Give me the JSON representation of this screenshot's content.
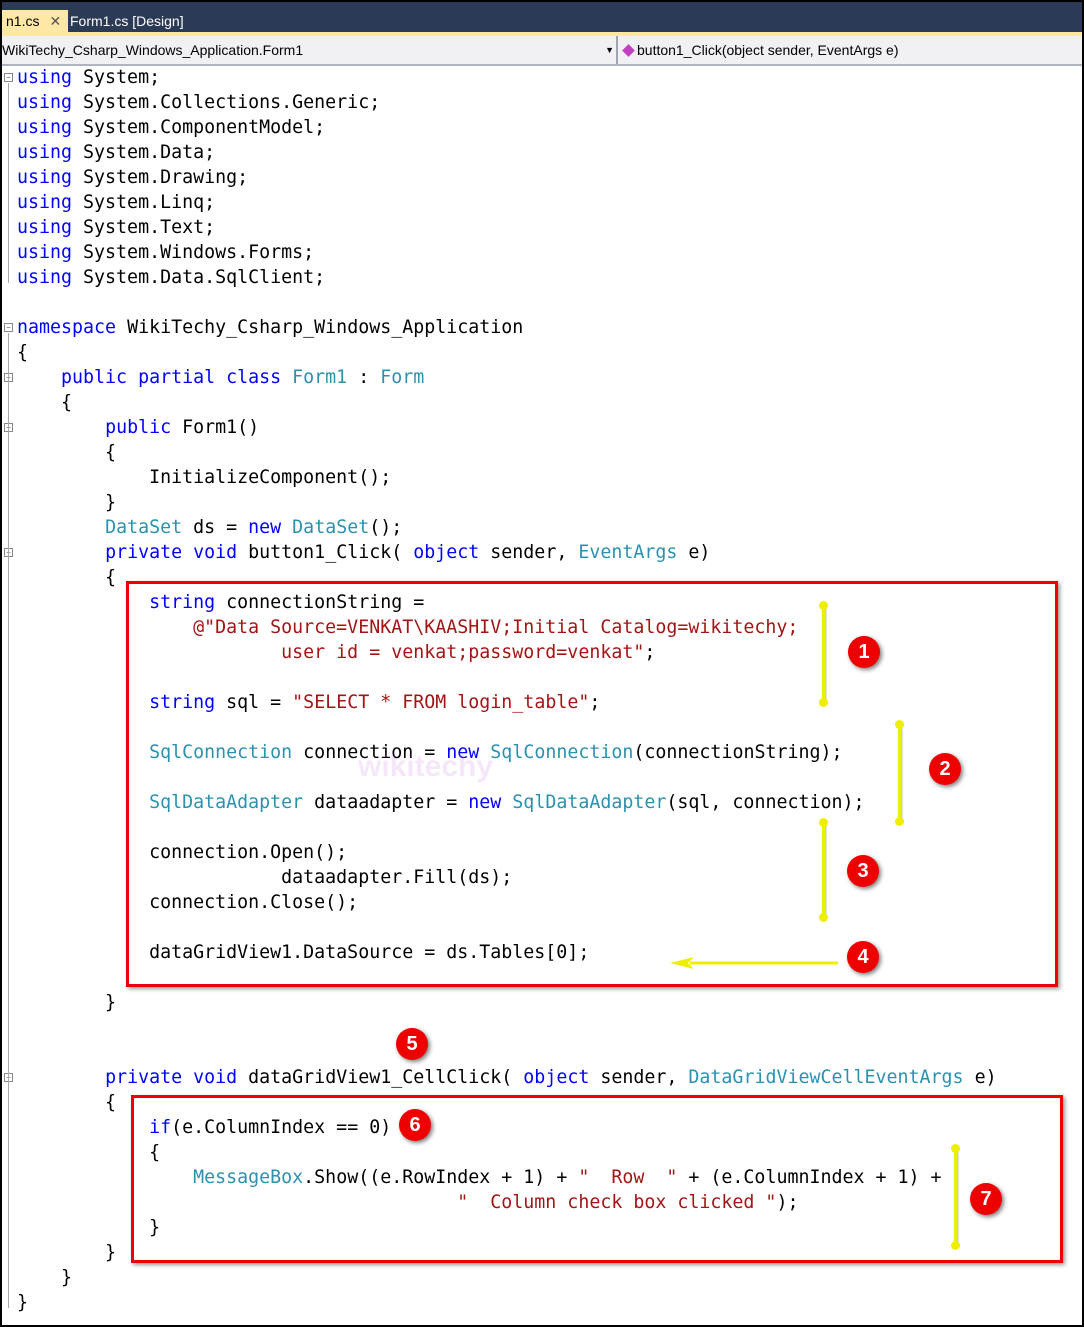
{
  "tabs": [
    {
      "label": "n1.cs",
      "close": "✕"
    },
    {
      "label": "Form1.cs [Design]"
    }
  ],
  "nav": {
    "class_selector": "WikiTechy_Csharp_Windows_Application.Form1",
    "member_selector": "button1_Click(object sender, EventArgs e)"
  },
  "watermark": "wikitechy",
  "colors": {
    "keyword": "#0000ff",
    "type": "#2b91af",
    "string": "#a31515",
    "annotation_box": "#ee0000",
    "annotation_line": "#eeee00"
  },
  "annotations": [
    "1",
    "2",
    "3",
    "4",
    "5",
    "6",
    "7"
  ],
  "code": [
    [
      [
        "kw",
        "using"
      ],
      [
        "",
        "System;"
      ]
    ],
    [
      [
        "kw",
        "using"
      ],
      [
        "",
        "System.Collections.Generic;"
      ]
    ],
    [
      [
        "kw",
        "using"
      ],
      [
        "",
        "System.ComponentModel;"
      ]
    ],
    [
      [
        "kw",
        "using"
      ],
      [
        "",
        "System.Data;"
      ]
    ],
    [
      [
        "kw",
        "using"
      ],
      [
        "",
        "System.Drawing;"
      ]
    ],
    [
      [
        "kw",
        "using"
      ],
      [
        "",
        "System.Linq;"
      ]
    ],
    [
      [
        "kw",
        "using"
      ],
      [
        "",
        "System.Text;"
      ]
    ],
    [
      [
        "kw",
        "using"
      ],
      [
        "",
        "System.Windows.Forms;"
      ]
    ],
    [
      [
        "kw",
        "using"
      ],
      [
        "",
        "System.Data.SqlClient;"
      ]
    ],
    [],
    [
      [
        "kw",
        "namespace"
      ],
      [
        "",
        "WikiTechy_Csharp_Windows_Application"
      ]
    ],
    [
      [
        "",
        "{"
      ]
    ],
    [
      [
        "",
        "    "
      ],
      [
        "kw",
        "public partial class"
      ],
      [
        "ty",
        "Form1"
      ],
      [
        "",
        ":"
      ],
      [
        "ty",
        "Form"
      ]
    ],
    [
      [
        "",
        "    {"
      ]
    ],
    [
      [
        "",
        "        "
      ],
      [
        "kw",
        "public"
      ],
      [
        "",
        "Form1()"
      ]
    ],
    [
      [
        "",
        "        {"
      ]
    ],
    [
      [
        "",
        "            InitializeComponent();"
      ]
    ],
    [
      [
        "",
        "        }"
      ]
    ],
    [
      [
        "",
        "        "
      ],
      [
        "ty",
        "DataSet"
      ],
      [
        "",
        "ds ="
      ],
      [
        "kw",
        "new"
      ],
      [
        "ty",
        "DataSet"
      ],
      [
        "",
        "();"
      ]
    ],
    [
      [
        "",
        "        "
      ],
      [
        "kw",
        "private void"
      ],
      [
        "",
        "button1_Click("
      ],
      [
        "kw",
        "object"
      ],
      [
        "",
        "sender,"
      ],
      [
        "ty",
        "EventArgs"
      ],
      [
        "",
        "e)"
      ]
    ],
    [
      [
        "",
        "        {"
      ]
    ],
    [
      [
        "",
        "            "
      ],
      [
        "kw",
        "string"
      ],
      [
        "",
        "connectionString ="
      ]
    ],
    [
      [
        "st",
        "                @\"Data Source=VENKAT\\KAASHIV;Initial Catalog=wikitechy;"
      ]
    ],
    [
      [
        "st",
        "                        user id = venkat;password=venkat\""
      ],
      [
        "",
        ";"
      ]
    ],
    [],
    [
      [
        "",
        "            "
      ],
      [
        "kw",
        "string"
      ],
      [
        "",
        "sql ="
      ],
      [
        "st",
        "\"SELECT * FROM login_table\""
      ],
      [
        "",
        ";"
      ]
    ],
    [],
    [
      [
        "",
        "            "
      ],
      [
        "ty",
        "SqlConnection"
      ],
      [
        "",
        "connection ="
      ],
      [
        "kw",
        "new"
      ],
      [
        "ty",
        "SqlConnection"
      ],
      [
        "",
        "(connectionString);"
      ]
    ],
    [],
    [
      [
        "",
        "            "
      ],
      [
        "ty",
        "SqlDataAdapter"
      ],
      [
        "",
        "dataadapter ="
      ],
      [
        "kw",
        "new"
      ],
      [
        "ty",
        "SqlDataAdapter"
      ],
      [
        "",
        "(sql, connection);"
      ]
    ],
    [],
    [
      [
        "",
        "            connection.Open();"
      ]
    ],
    [
      [
        "",
        "                        dataadapter.Fill(ds);"
      ]
    ],
    [
      [
        "",
        "            connection.Close();"
      ]
    ],
    [],
    [
      [
        "",
        "            dataGridView1.DataSource = ds.Tables[0];"
      ]
    ],
    [],
    [
      [
        "",
        "        }"
      ]
    ],
    [],
    [],
    [
      [
        "",
        "        "
      ],
      [
        "kw",
        "private void"
      ],
      [
        "",
        "dataGridView1_CellClick("
      ],
      [
        "kw",
        "object"
      ],
      [
        "",
        "sender,"
      ],
      [
        "ty",
        "DataGridViewCellEventArgs"
      ],
      [
        "",
        "e)"
      ]
    ],
    [
      [
        "",
        "        {"
      ]
    ],
    [
      [
        "",
        "            "
      ],
      [
        "kw",
        "if"
      ],
      [
        "",
        "(e.ColumnIndex == 0)"
      ]
    ],
    [
      [
        "",
        "            {"
      ]
    ],
    [
      [
        "",
        "                "
      ],
      [
        "ty",
        "MessageBox"
      ],
      [
        "",
        ".Show((e.RowIndex + 1) + "
      ],
      [
        "st",
        "\"  Row  \""
      ],
      [
        "",
        ""
      ],
      [
        "",
        "+ (e.ColumnIndex + 1) +"
      ]
    ],
    [
      [
        "",
        "                                        "
      ],
      [
        "st",
        "\"  Column check box clicked \""
      ],
      [
        "",
        ");"
      ]
    ],
    [
      [
        "",
        "            }"
      ]
    ],
    [
      [
        "",
        "        }"
      ]
    ],
    [
      [
        "",
        "    }"
      ]
    ],
    [
      [
        "",
        "}"
      ]
    ]
  ]
}
